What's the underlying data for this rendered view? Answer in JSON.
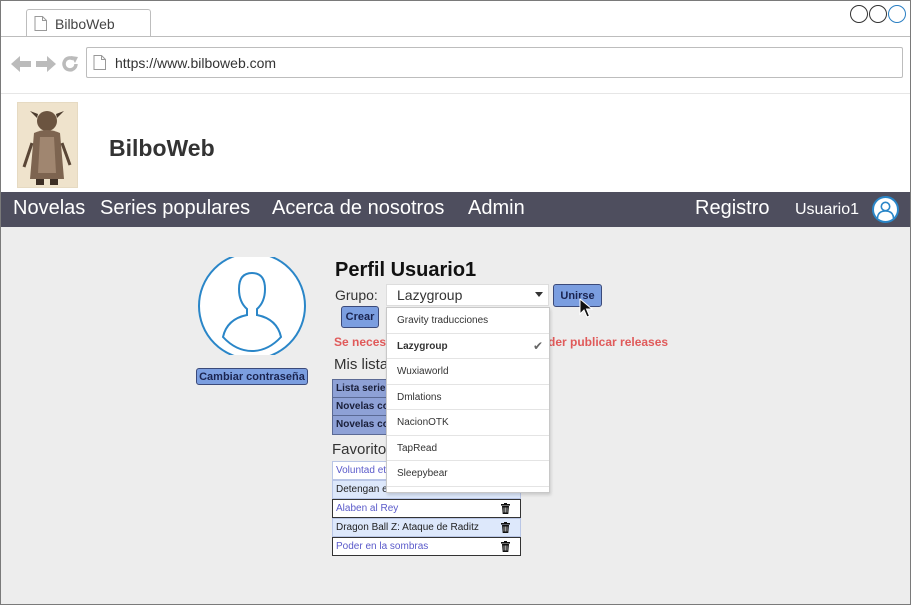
{
  "browser": {
    "tab_title": "BilboWeb",
    "url": "https://www.bilboweb.com"
  },
  "site": {
    "title": "BilboWeb"
  },
  "nav": {
    "items": [
      "Novelas",
      "Series populares",
      "Acerca de nosotros",
      "Admin"
    ],
    "register": "Registro",
    "username": "Usuario1"
  },
  "profile": {
    "title": "Perfil Usuario1",
    "group_label": "Grupo:",
    "group_selected": "Lazygroup",
    "join_button": "Unirse",
    "create_button": "Crear",
    "change_password_button": "Cambiar contraseña",
    "warning_start": "Se necesi",
    "warning_end": "der publicar releases",
    "lists_title": "Mis lista",
    "lists": [
      "Lista serie",
      "Novelas co",
      "Novelas co"
    ],
    "favorites_title": "Favorito",
    "favorites": [
      {
        "name": "Voluntad et",
        "style": "link",
        "trash": false
      },
      {
        "name": "Detengan e",
        "style": "plain",
        "trash": false
      },
      {
        "name": "Alaben al Rey",
        "style": "link",
        "trash": true
      },
      {
        "name": "Dragon Ball Z: Ataque de Raditz",
        "style": "plain",
        "trash": true
      },
      {
        "name": "Poder en la sombras",
        "style": "link",
        "trash": true
      }
    ]
  },
  "dropdown": {
    "options": [
      "Gravity traducciones",
      "Lazygroup",
      "Wuxiaworld",
      "Dmlations",
      "NacionOTK",
      "TapRead",
      "Sleepybear"
    ],
    "selected_index": 1
  },
  "colors": {
    "nav_bg": "#4e4e5e",
    "content_bg": "#ededed",
    "button_bg": "#7b9ee0",
    "warning": "#e05a5a",
    "accent_blue": "#2a86c8"
  }
}
